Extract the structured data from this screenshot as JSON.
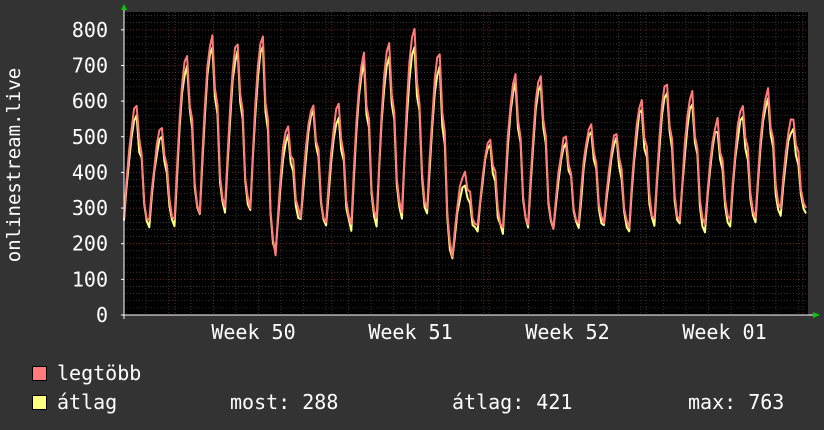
{
  "chart_data": {
    "type": "line",
    "ylabel": "onlinestream.live",
    "ylim": [
      0,
      850
    ],
    "y_ticks": [
      0,
      100,
      200,
      300,
      400,
      500,
      600,
      700,
      800
    ],
    "x_ticks": [
      "Week 50",
      "Week 51",
      "Week 52",
      "Week 01"
    ],
    "grid": true,
    "colors": {
      "background": "#333333",
      "plot": "#000000",
      "grid": "#555555",
      "vgrid": "#8a2a2a",
      "axis": "#ffffff",
      "arrow": "#00cc00"
    },
    "series": [
      {
        "name": "legtöbb",
        "color": "#ff7b7b",
        "peaks": [
          590,
          530,
          735,
          785,
          765,
          790,
          530,
          595,
          585,
          730,
          760,
          805,
          735,
          400,
          500,
          675,
          670,
          500,
          540,
          515,
          600,
          655,
          620,
          545,
          585,
          630,
          555
        ],
        "troughs": [
          280,
          260,
          270,
          290,
          300,
          300,
          175,
          280,
          260,
          260,
          270,
          290,
          300,
          170,
          250,
          250,
          260,
          250,
          260,
          260,
          250,
          270,
          265,
          250,
          270,
          280,
          300
        ]
      },
      {
        "name": "átlag",
        "color": "#ffff80",
        "peaks": [
          560,
          505,
          700,
          755,
          735,
          760,
          500,
          565,
          555,
          700,
          730,
          760,
          700,
          370,
          475,
          650,
          645,
          475,
          515,
          490,
          575,
          625,
          595,
          520,
          560,
          600,
          525
        ],
        "troughs": [
          265,
          250,
          255,
          280,
          290,
          290,
          170,
          265,
          250,
          245,
          255,
          275,
          285,
          165,
          235,
          235,
          245,
          235,
          245,
          245,
          240,
          255,
          250,
          240,
          255,
          265,
          285
        ]
      }
    ]
  },
  "legend": {
    "max_label": "legtöbb",
    "avg_label": "átlag",
    "stats": {
      "now": "most: 288",
      "average": "átlag: 421",
      "max": "max: 763"
    }
  }
}
